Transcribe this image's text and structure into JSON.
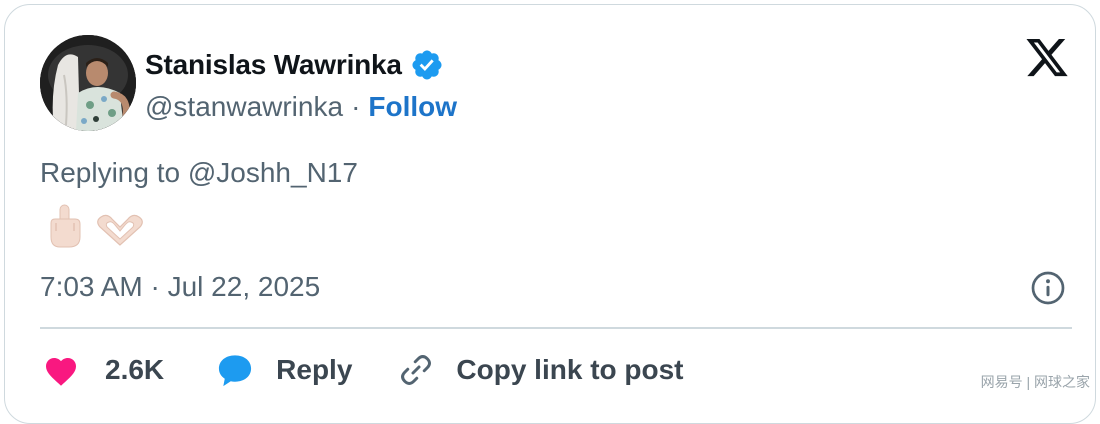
{
  "author": {
    "name": "Stanislas Wawrinka",
    "handle": "@stanwawrinka",
    "separator": "·",
    "follow_label": "Follow"
  },
  "tweet": {
    "reply_context": "Replying to @Joshh_N17",
    "emojis": [
      "middle-finger-light-skin",
      "heart-hands-light-skin"
    ],
    "timestamp": "7:03 AM · Jul 22, 2025"
  },
  "actions": {
    "like_count": "2.6K",
    "reply_label": "Reply",
    "copy_label": "Copy link to post"
  },
  "icons": {
    "brand": "x-logo-icon",
    "verified": "verified-badge-icon",
    "info": "info-icon",
    "like": "heart-icon",
    "reply": "speech-bubble-icon",
    "copy": "link-icon"
  },
  "colors": {
    "verified": "#1d9bf0",
    "follow": "#1d74c9",
    "like": "#f91880",
    "reply": "#1d9bf0",
    "muted_text": "#536471",
    "border": "#cfd9de"
  },
  "watermark": "网易号 | 网球之家"
}
